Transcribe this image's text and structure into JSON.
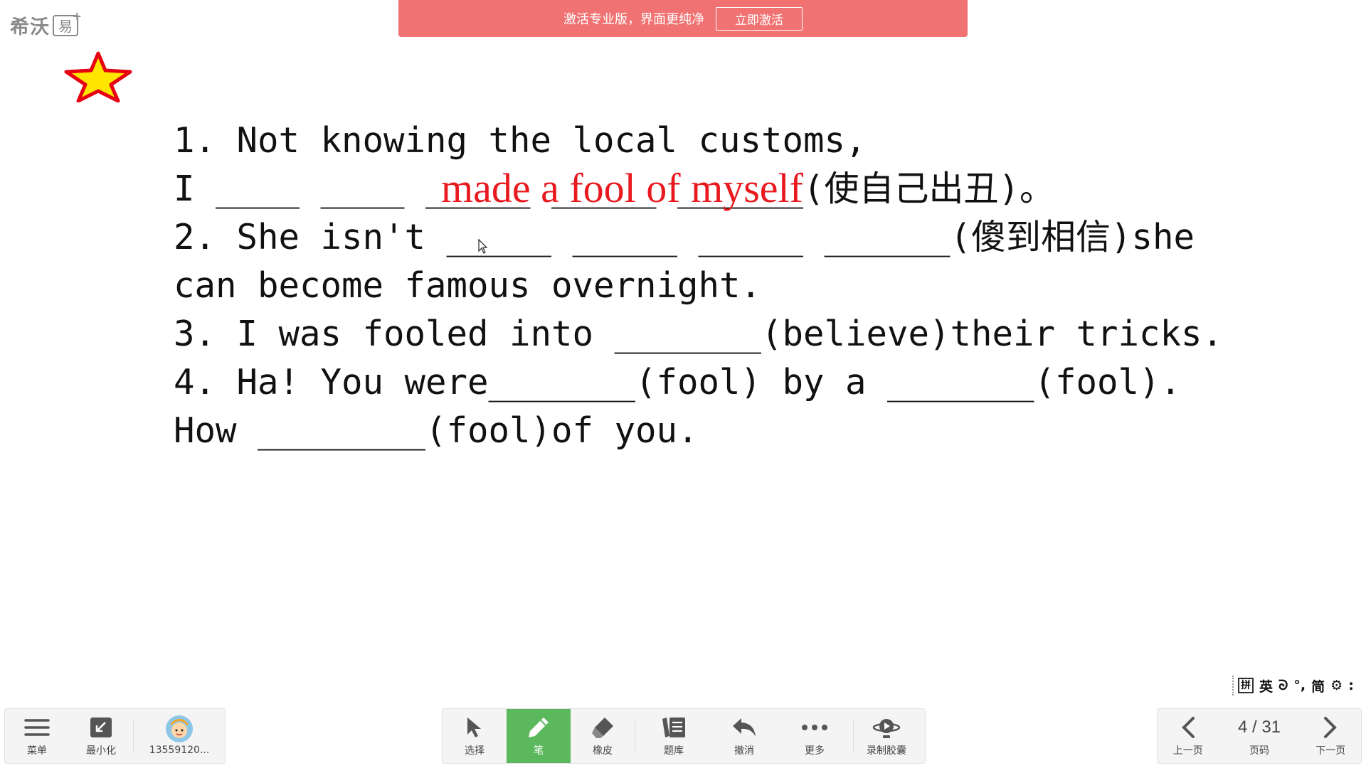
{
  "logo": {
    "text": "希沃",
    "badge": "易",
    "plus": "+"
  },
  "banner": {
    "message": "激活专业版，界面更纯净",
    "button": "立即激活"
  },
  "slide": {
    "lines": [
      "1. Not knowing the local customs,",
      "I ____ ____ _____ _____ ______(使自己出丑)。",
      "2. She isn't _____ _____ _____ ______(傻到相信)she",
      "can become famous overnight.",
      "3. I was fooled into _______(believe)their tricks.",
      "4. Ha! You were_______(fool) by a _______(fool).",
      "How ________(fool)of you."
    ],
    "handwritten_answer": "made a fool of myself"
  },
  "ime": {
    "items": [
      "拼",
      "英",
      "ᘐ",
      "°,",
      "简",
      "⚙",
      ":"
    ]
  },
  "left_toolbar": {
    "menu": "菜单",
    "minimize": "最小化",
    "user": "13559120..."
  },
  "center_toolbar": {
    "select": "选择",
    "pen": "笔",
    "eraser": "橡皮",
    "question_bank": "题库",
    "undo": "撤消",
    "more": "更多",
    "record": "录制胶囊"
  },
  "pager": {
    "prev": "上一页",
    "page": "4 / 31",
    "page_label": "页码",
    "next": "下一页"
  },
  "colors": {
    "banner": "#f07273",
    "pen_active": "#5cb85c",
    "answer": "#e8191f",
    "star_fill": "#ffe600",
    "star_stroke": "#e60012"
  }
}
